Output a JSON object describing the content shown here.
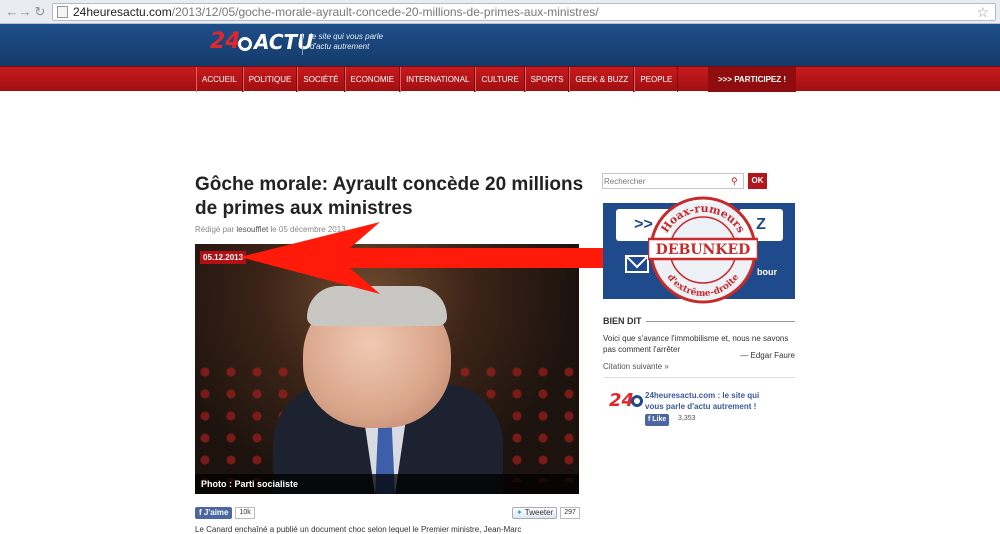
{
  "browser": {
    "url_host": "24heuresactu.com",
    "url_path": "/2013/12/05/goche-morale-ayrault-concede-20-millions-de-primes-aux-ministres/"
  },
  "site": {
    "logo_num": "24",
    "logo_word": "ACTU",
    "tagline": "le site qui vous parle d'actu autrement"
  },
  "nav": {
    "items": [
      "ACCUEIL",
      "POLITIQUE",
      "SOCIÉTÉ",
      "ECONOMIE",
      "INTERNATIONAL",
      "CULTURE",
      "SPORTS",
      "GEEK & BUZZ",
      "PEOPLE"
    ],
    "participate": ">>> PARTICIPEZ !"
  },
  "article": {
    "title": "Gôche morale: Ayrault concède 20 millions de primes aux ministres",
    "byline_prefix": "Rédigé par",
    "author": "lesoufflet",
    "byline_suffix": "le 05 décembre 2013",
    "date_badge": "05.12.2013",
    "photo_caption": "Photo : Parti socialiste",
    "fb_like": "J'aime",
    "fb_count": "10k",
    "tweet": "Tweeter",
    "tweet_count": "297",
    "lead_text": "Le Canard enchaîné a publié un document choc selon lequel le Premier ministre, Jean-Marc"
  },
  "sidebar": {
    "search_placeholder": "Rechercher",
    "ok_label": "OK",
    "promo_left": ">>",
    "promo_right": "Z",
    "promo_text": "bour",
    "stamp_top": "Hoax-rumeurs",
    "stamp_mid": "DEBUNKED",
    "stamp_bottom": "d'extrême-droite",
    "bien_dit": "BIEN DIT",
    "quote": "Voici que s'avance l'immobilisme et, nous ne savons pas comment l'arrêter",
    "quote_author": "— Edgar Faure",
    "citation_link": "Citation suivante »",
    "fb_page_num": "24",
    "fb_page_title": "24heuresactu.com : le site qui vous parle d'actu autrement !",
    "fb_like": "Like",
    "fb_count": "3,353"
  },
  "colors": {
    "brand_blue": "#1f4f8a",
    "brand_red": "#c71a1d",
    "annotation_arrow": "#ff1a0a",
    "stamp": "#c62a2a"
  }
}
